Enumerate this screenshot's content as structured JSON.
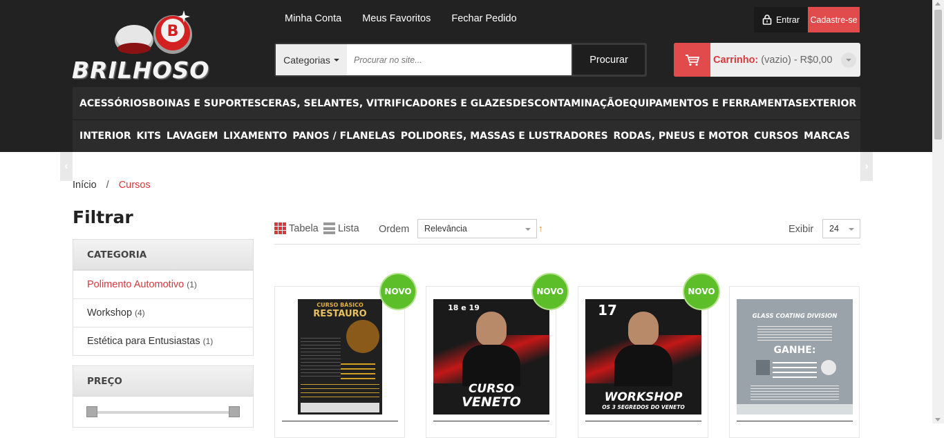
{
  "brand": {
    "logo_text": "BRILHOSO",
    "logo_letter": "B"
  },
  "top_links": [
    "Minha Conta",
    "Meus Favoritos",
    "Fechar Pedido"
  ],
  "auth": {
    "login": "Entrar",
    "signup": "Cadastre-se"
  },
  "search": {
    "categories": "Categorias",
    "placeholder": "Procurar no site...",
    "button": "Procurar"
  },
  "cart": {
    "label": "Carrinho:",
    "status": "(vazio) - R$0,00"
  },
  "nav": {
    "row1": [
      "ACESSÓRIOS",
      "BOINAS E SUPORTES",
      "CERAS, SELANTES, VITRIFICADORES E GLAZES",
      "DESCONTAMINAÇÃO",
      "EQUIPAMENTOS E FERRAMENTAS",
      "EXTERIOR"
    ],
    "row2": [
      "INTERIOR",
      "KITS",
      "LAVAGEM",
      "LIXAMENTO",
      "PANOS / FLANELAS",
      "POLIDORES, MASSAS E LUSTRADORES",
      "RODAS, PNEUS E MOTOR",
      "CURSOS",
      "MARCAS"
    ]
  },
  "breadcrumb": {
    "home": "Início",
    "sep": "/",
    "current": "Cursos"
  },
  "filter": {
    "title": "Filtrar",
    "category_header": "CATEGORIA",
    "categories": [
      {
        "label": "Polimento Automotivo",
        "count": "(1)"
      },
      {
        "label": "Workshop",
        "count": "(4)"
      },
      {
        "label": "Estética para Entusiastas",
        "count": "(1)"
      }
    ],
    "price_header": "PREÇO"
  },
  "toolbar": {
    "table": "Tabela",
    "list": "Lista",
    "order_label": "Ordem",
    "order_value": "Relevância",
    "show_label": "Exibir",
    "show_value": "24"
  },
  "badge": "NOVO",
  "products": [
    {
      "poster_lines": [
        "CURSO BÁSICO",
        "RESTAURO"
      ]
    },
    {
      "poster_lines": [
        "18 e 19",
        "CURSO",
        "VENETO"
      ]
    },
    {
      "poster_lines": [
        "17",
        "WORKSHOP",
        "OS 3 SEGREDOS DO VENETO"
      ]
    },
    {
      "poster_lines": [
        "GLASS COATING DIVISION",
        "GANHE:"
      ]
    }
  ],
  "colors": {
    "accent": "#d9373c",
    "header_bg": "#222222",
    "badge": "#5cbf2a"
  }
}
